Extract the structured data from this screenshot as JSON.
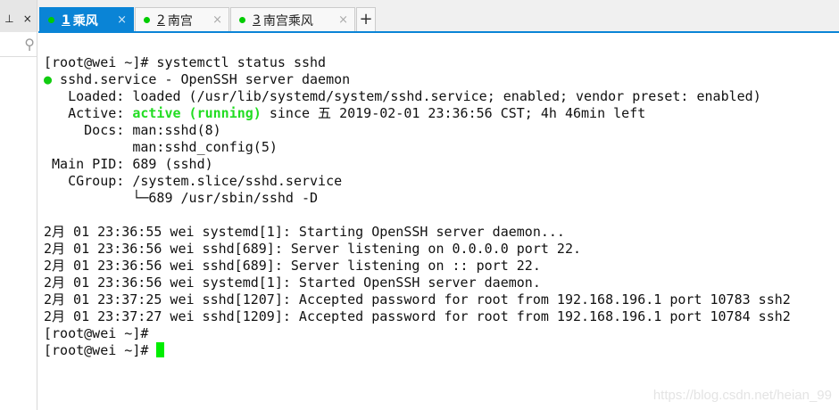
{
  "left_panel": {
    "pin_icon": "pin-icon",
    "close_label": "×",
    "search_icon": "magnifier-icon"
  },
  "tabs": [
    {
      "num": "1",
      "label": "乘风",
      "close": "×",
      "status_color": "#00cc00",
      "active": true
    },
    {
      "num": "2",
      "label": "南宫",
      "close": "×",
      "status_color": "#00cc00",
      "active": false
    },
    {
      "num": "3",
      "label": "南宫乘风",
      "close": "×",
      "status_color": "#00cc00",
      "active": false
    }
  ],
  "add_tab_label": "+",
  "terminal": {
    "lines": [
      "[root@wei ~]# systemctl status sshd",
      " sshd.service - OpenSSH server daemon",
      "   Loaded: loaded (/usr/lib/systemd/system/sshd.service; enabled; vendor preset: enabled)",
      "   Active: ",
      "     Docs: man:sshd(8)",
      "           man:sshd_config(5)",
      " Main PID: 689 (sshd)",
      "   CGroup: /system.slice/sshd.service",
      "           └─689 /usr/sbin/sshd -D",
      "",
      "2月 01 23:36:55 wei systemd[1]: Starting OpenSSH server daemon...",
      "2月 01 23:36:56 wei sshd[689]: Server listening on 0.0.0.0 port 22.",
      "2月 01 23:36:56 wei sshd[689]: Server listening on :: port 22.",
      "2月 01 23:36:56 wei systemd[1]: Started OpenSSH server daemon.",
      "2月 01 23:37:25 wei sshd[1207]: Accepted password for root from 192.168.196.1 port 10783 ssh2",
      "2月 01 23:37:27 wei sshd[1209]: Accepted password for root from 192.168.196.1 port 10784 ssh2",
      "[root@wei ~]#",
      "[root@wei ~]# "
    ],
    "status_bullet": "●",
    "active_state": "active (running)",
    "active_rest": " since 五 2019-02-01 23:36:56 CST; 4h 46min left"
  },
  "watermark": "https://blog.csdn.net/heian_99"
}
